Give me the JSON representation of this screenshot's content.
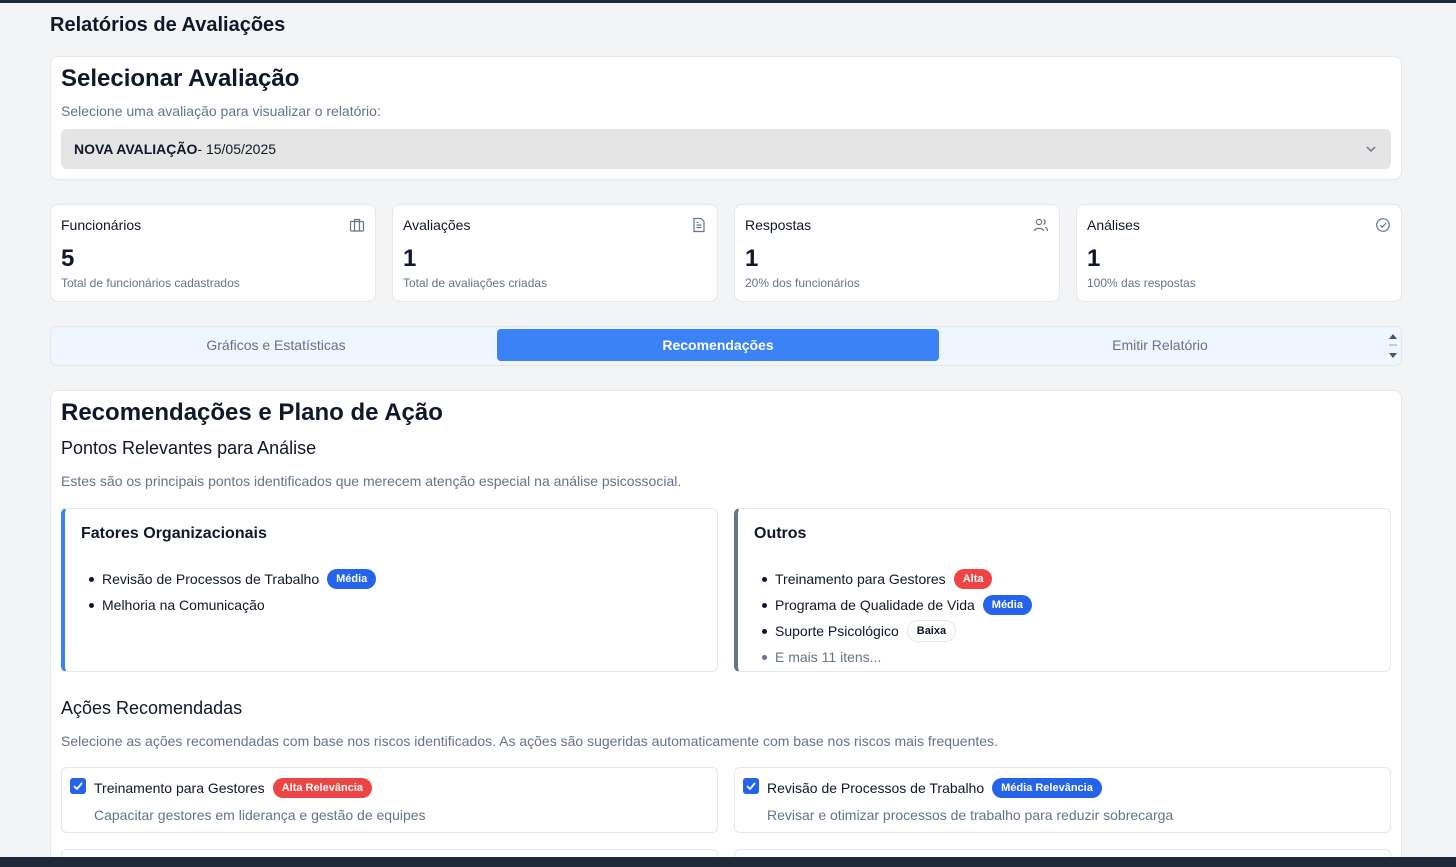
{
  "page": {
    "title": "Relatórios de Avaliações"
  },
  "select": {
    "heading": "Selecionar Avaliação",
    "hint": "Selecione uma avaliação para visualizar o relatório:",
    "selected_name": "NOVA AVALIAÇÃO",
    "selected_date": " - 15/05/2025"
  },
  "stats": [
    {
      "label": "Funcionários",
      "value": "5",
      "sub": "Total de funcionários cadastrados",
      "icon": "briefcase-icon"
    },
    {
      "label": "Avaliações",
      "value": "1",
      "sub": "Total de avaliações criadas",
      "icon": "document-icon"
    },
    {
      "label": "Respostas",
      "value": "1",
      "sub": "20% dos funcionários",
      "icon": "users-icon"
    },
    {
      "label": "Análises",
      "value": "1",
      "sub": "100% das respostas",
      "icon": "check-circle-icon"
    }
  ],
  "tabs": [
    {
      "label": "Gráficos e Estatísticas",
      "active": false
    },
    {
      "label": "Recomendações",
      "active": true
    },
    {
      "label": "Emitir Relatório",
      "active": false
    }
  ],
  "main": {
    "heading": "Recomendações e Plano de Ação",
    "points_heading": "Pontos Relevantes para Análise",
    "points_desc": "Estes são os principais pontos identificados que merecem atenção especial na análise psicossocial.",
    "panels": [
      {
        "title": "Fatores Organizacionais",
        "items": [
          {
            "text": "Revisão de Processos de Trabalho",
            "badge": "Média"
          },
          {
            "text": "Melhoria na Comunicação",
            "badge": ""
          }
        ]
      },
      {
        "title": "Outros",
        "items": [
          {
            "text": "Treinamento para Gestores",
            "badge": "Alta"
          },
          {
            "text": "Programa de Qualidade de Vida",
            "badge": "Média"
          },
          {
            "text": "Suporte Psicológico",
            "badge": "Baixa"
          }
        ],
        "more": "E mais 11 itens..."
      }
    ],
    "actions_heading": "Ações Recomendadas",
    "actions_desc": "Selecione as ações recomendadas com base nos riscos identificados. As ações são sugeridas automaticamente com base nos riscos mais frequentes.",
    "actions": [
      {
        "title": "Treinamento para Gestores",
        "badge": "Alta Relevância",
        "desc": "Capacitar gestores em liderança e gestão de equipes",
        "checked": true
      },
      {
        "title": "Revisão de Processos de Trabalho",
        "badge": "Média Relevância",
        "desc": "Revisar e otimizar processos de trabalho para reduzir sobrecarga",
        "checked": true
      }
    ]
  },
  "colors": {
    "primary": "#3b82f6",
    "alta": "#ef4444",
    "media": "#2563eb",
    "muted": "#64748b"
  }
}
